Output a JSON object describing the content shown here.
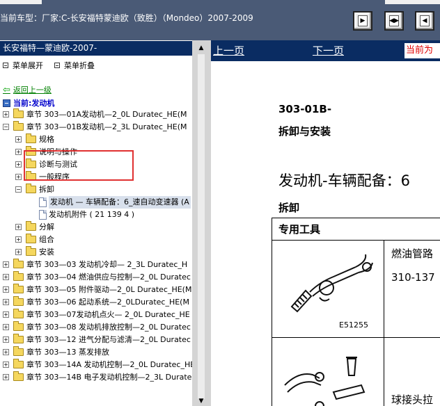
{
  "header": {
    "vehicle_title": "当前车型：厂家:C-长安福特蒙迪欧（致胜）（Mondeo）2007-2009",
    "buttons": [
      {
        "name": "first-page-button",
        "icon": "doc-right-arrow-icon"
      },
      {
        "name": "expand-button",
        "icon": "doc-double-arrow-icon"
      },
      {
        "name": "next-page-button",
        "icon": "doc-left-arrow-icon"
      }
    ]
  },
  "sidebar": {
    "title": "长安福特—蒙迪欧-2007-",
    "expand_all": "菜单展开",
    "collapse_all": "菜单折叠",
    "back": "返回上一级",
    "current": "当前:发动机",
    "tree": [
      {
        "level": 0,
        "expander": "+",
        "icon": "folder",
        "label": "章节 303—01A发动机—2_0L Duratec_HE(M",
        "selected": false
      },
      {
        "level": 0,
        "expander": "-",
        "icon": "folder",
        "label": "章节 303—01B发动机—2_3L Duratec_HE(M",
        "selected": false
      },
      {
        "level": 1,
        "expander": "+",
        "icon": "folder",
        "label": "规格",
        "selected": false
      },
      {
        "level": 1,
        "expander": "+",
        "icon": "folder",
        "label": "说明与操作",
        "selected": false
      },
      {
        "level": 1,
        "expander": "+",
        "icon": "folder",
        "label": "诊断与测试",
        "selected": false
      },
      {
        "level": 1,
        "expander": "+",
        "icon": "folder",
        "label": "一般程序",
        "selected": false
      },
      {
        "level": 1,
        "expander": "-",
        "icon": "folder",
        "label": "拆卸",
        "selected": false
      },
      {
        "level": 2,
        "expander": "",
        "icon": "page",
        "label": "发动机 — 车辆配备：6_速自动变速器 (A",
        "selected": true
      },
      {
        "level": 2,
        "expander": "",
        "icon": "page",
        "label": "发动机附件 ( 21 139 4 )",
        "selected": false
      },
      {
        "level": 1,
        "expander": "+",
        "icon": "folder",
        "label": "分解",
        "selected": false
      },
      {
        "level": 1,
        "expander": "+",
        "icon": "folder",
        "label": "组合",
        "selected": false
      },
      {
        "level": 1,
        "expander": "+",
        "icon": "folder",
        "label": "安装",
        "selected": false
      },
      {
        "level": 0,
        "expander": "+",
        "icon": "folder",
        "label": "章节 303—03 发动机冷却— 2_3L Duratec_H",
        "selected": false
      },
      {
        "level": 0,
        "expander": "+",
        "icon": "folder",
        "label": "章节 303—04 燃油供应与控制—2_0L Duratec",
        "selected": false
      },
      {
        "level": 0,
        "expander": "+",
        "icon": "folder",
        "label": "章节 303—05 附件驱动—2_0L Duratec_HE(M",
        "selected": false
      },
      {
        "level": 0,
        "expander": "+",
        "icon": "folder",
        "label": "章节 303—06 起动系统—2_0LDuratec_HE(M",
        "selected": false
      },
      {
        "level": 0,
        "expander": "+",
        "icon": "folder",
        "label": "章节 303—07发动机点火— 2_0L Duratec_HE",
        "selected": false
      },
      {
        "level": 0,
        "expander": "+",
        "icon": "folder",
        "label": "章节 303—08 发动机排放控制—2_0L Duratec",
        "selected": false
      },
      {
        "level": 0,
        "expander": "+",
        "icon": "folder",
        "label": "章节 303—12 进气分配与滤清—2_0L Duratec",
        "selected": false
      },
      {
        "level": 0,
        "expander": "+",
        "icon": "folder",
        "label": "章节 303—13 蒸发排放",
        "selected": false
      },
      {
        "level": 0,
        "expander": "+",
        "icon": "folder",
        "label": "章节 303—14A 发动机控制—2_0L Duratec_HE",
        "selected": false
      },
      {
        "level": 0,
        "expander": "+",
        "icon": "folder",
        "label": "章节 303—14B 电子发动机控制—2_3L Durate",
        "selected": false
      }
    ]
  },
  "viewer": {
    "prev_page": "上一页",
    "next_page": "下一页",
    "current_position": "当前为",
    "doc_code": "303-01B-",
    "doc_section": "拆卸与安装",
    "doc_heading": "发动机-车辆配备：6",
    "removal": "拆卸",
    "special_tools": "专用工具",
    "tool1_name": "燃油管路",
    "tool1_number": "310-137",
    "tool1_caption": "E51255",
    "tool2_name": "球接头拉"
  },
  "colors": {
    "topbar_bg": "#4a5a76",
    "nav_bg": "#0a2c62",
    "highlight_box": "#e03030",
    "link_green": "#008000",
    "current_blue": "#0000cc"
  }
}
